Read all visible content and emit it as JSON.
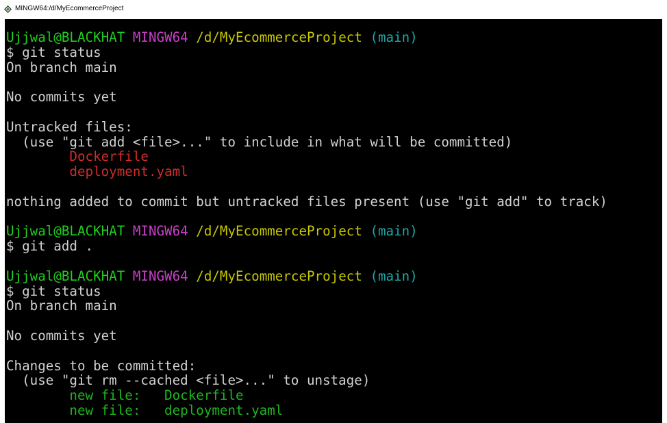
{
  "window": {
    "title": "MINGW64:/d/MyEcommerceProject"
  },
  "terminal": {
    "lines": [
      [
        {
          "text": "Ujjwal@BLACKHAT",
          "color": "user"
        },
        {
          "text": " ",
          "color": "white"
        },
        {
          "text": "MINGW64",
          "color": "sys"
        },
        {
          "text": " ",
          "color": "white"
        },
        {
          "text": "/d/MyEcommerceProject",
          "color": "path"
        },
        {
          "text": " ",
          "color": "white"
        },
        {
          "text": "(main)",
          "color": "branch"
        }
      ],
      [
        {
          "text": "$ git status",
          "color": "white"
        }
      ],
      [
        {
          "text": "On branch main",
          "color": "white"
        }
      ],
      [
        {
          "text": "",
          "color": "white"
        }
      ],
      [
        {
          "text": "No commits yet",
          "color": "white"
        }
      ],
      [
        {
          "text": "",
          "color": "white"
        }
      ],
      [
        {
          "text": "Untracked files:",
          "color": "white"
        }
      ],
      [
        {
          "text": "  (use \"git add <file>...\" to include in what will be committed)",
          "color": "white"
        }
      ],
      [
        {
          "text": "        ",
          "color": "white"
        },
        {
          "text": "Dockerfile",
          "color": "red"
        }
      ],
      [
        {
          "text": "        ",
          "color": "white"
        },
        {
          "text": "deployment.yaml",
          "color": "red"
        }
      ],
      [
        {
          "text": "",
          "color": "white"
        }
      ],
      [
        {
          "text": "nothing added to commit but untracked files present (use \"git add\" to track)",
          "color": "white"
        }
      ],
      [
        {
          "text": "",
          "color": "white"
        }
      ],
      [
        {
          "text": "Ujjwal@BLACKHAT",
          "color": "user"
        },
        {
          "text": " ",
          "color": "white"
        },
        {
          "text": "MINGW64",
          "color": "sys"
        },
        {
          "text": " ",
          "color": "white"
        },
        {
          "text": "/d/MyEcommerceProject",
          "color": "path"
        },
        {
          "text": " ",
          "color": "white"
        },
        {
          "text": "(main)",
          "color": "branch"
        }
      ],
      [
        {
          "text": "$ git add .",
          "color": "white"
        }
      ],
      [
        {
          "text": "",
          "color": "white"
        }
      ],
      [
        {
          "text": "Ujjwal@BLACKHAT",
          "color": "user"
        },
        {
          "text": " ",
          "color": "white"
        },
        {
          "text": "MINGW64",
          "color": "sys"
        },
        {
          "text": " ",
          "color": "white"
        },
        {
          "text": "/d/MyEcommerceProject",
          "color": "path"
        },
        {
          "text": " ",
          "color": "white"
        },
        {
          "text": "(main)",
          "color": "branch"
        }
      ],
      [
        {
          "text": "$ git status",
          "color": "white"
        }
      ],
      [
        {
          "text": "On branch main",
          "color": "white"
        }
      ],
      [
        {
          "text": "",
          "color": "white"
        }
      ],
      [
        {
          "text": "No commits yet",
          "color": "white"
        }
      ],
      [
        {
          "text": "",
          "color": "white"
        }
      ],
      [
        {
          "text": "Changes to be committed:",
          "color": "white"
        }
      ],
      [
        {
          "text": "  (use \"git rm --cached <file>...\" to unstage)",
          "color": "white"
        }
      ],
      [
        {
          "text": "        ",
          "color": "white"
        },
        {
          "text": "new file:   Dockerfile",
          "color": "green"
        }
      ],
      [
        {
          "text": "        ",
          "color": "white"
        },
        {
          "text": "new file:   deployment.yaml",
          "color": "green"
        }
      ]
    ]
  },
  "colors": {
    "background": "#000000",
    "user": "#1fcf1f",
    "sys": "#c83fc8",
    "path": "#c8c800",
    "branch": "#1fa8a8",
    "red": "#d22b2b",
    "green": "#1fb51f",
    "white": "#d2d2d2"
  },
  "icons": {
    "app": "git-bash-icon"
  }
}
